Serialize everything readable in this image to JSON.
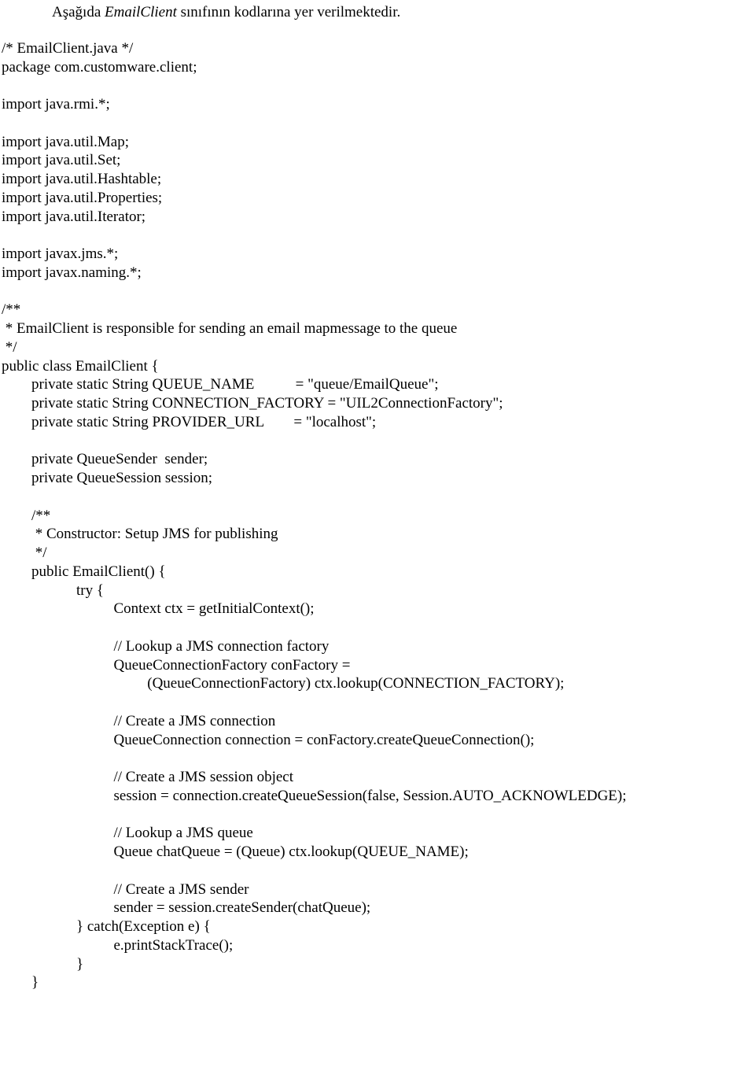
{
  "intro_prefix": "Aşağıda  ",
  "intro_em": "EmailClient",
  "intro_suffix": " sınıfının kodlarına yer verilmektedir.",
  "code": "/* EmailClient.java */\npackage com.customware.client;\n\nimport java.rmi.*;\n\nimport java.util.Map;\nimport java.util.Set;\nimport java.util.Hashtable;\nimport java.util.Properties;\nimport java.util.Iterator;\n\nimport javax.jms.*;\nimport javax.naming.*;\n\n/**\n * EmailClient is responsible for sending an email mapmessage to the queue\n */\npublic class EmailClient {\n        private static String QUEUE_NAME           = \"queue/EmailQueue\";\n        private static String CONNECTION_FACTORY = \"UIL2ConnectionFactory\";\n        private static String PROVIDER_URL        = \"localhost\";\n\n        private QueueSender  sender;\n        private QueueSession session;\n\n        /**\n         * Constructor: Setup JMS for publishing\n         */\n        public EmailClient() {\n                    try {\n                              Context ctx = getInitialContext();\n\n                              // Lookup a JMS connection factory\n                              QueueConnectionFactory conFactory =\n                                       (QueueConnectionFactory) ctx.lookup(CONNECTION_FACTORY);\n\n                              // Create a JMS connection\n                              QueueConnection connection = conFactory.createQueueConnection();\n\n                              // Create a JMS session object\n                              session = connection.createQueueSession(false, Session.AUTO_ACKNOWLEDGE);\n\n                              // Lookup a JMS queue\n                              Queue chatQueue = (Queue) ctx.lookup(QUEUE_NAME);\n\n                              // Create a JMS sender\n                              sender = session.createSender(chatQueue);\n                    } catch(Exception e) {\n                              e.printStackTrace();\n                    }\n        }"
}
